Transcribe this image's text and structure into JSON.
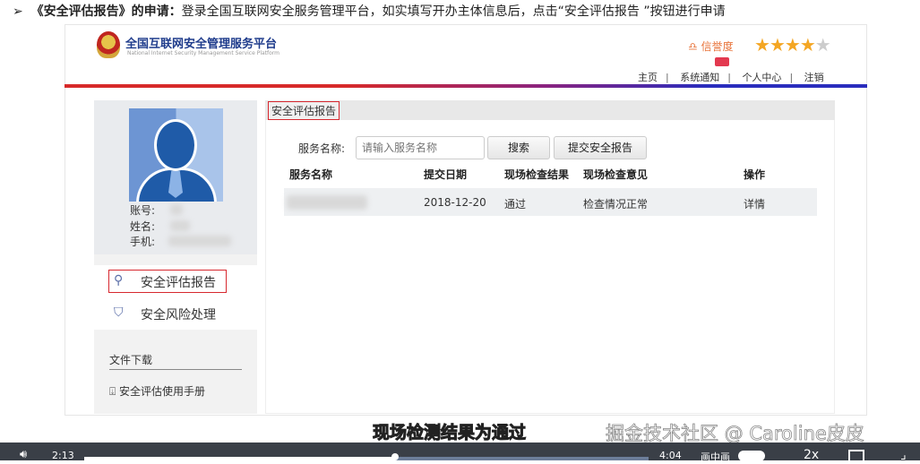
{
  "instruction": {
    "bullet": "➢",
    "bold": "《安全评估报告》的申请：",
    "text": "登录全国互联网安全服务管理平台，如实填写开办主体信息后，点击“安全评估报告 ”按钮进行申请"
  },
  "header": {
    "title": "全国互联网安全管理服务平台",
    "subtitle": "National Internet Security Management Service Platform",
    "credit_label": "信誉度",
    "stars": {
      "filled": 4,
      "total": 5
    },
    "nav": [
      "主页",
      "系统通知",
      "个人中心",
      "注销"
    ],
    "colors": {
      "accent_red": "#d72a2a",
      "accent_blue": "#2a2dbd"
    }
  },
  "profile": {
    "account_label": "账号:",
    "name_label": "姓名:",
    "phone_label": "手机:"
  },
  "sidebar": {
    "items": [
      {
        "label": "安全评估报告",
        "icon": "search-icon"
      },
      {
        "label": "安全风险处理",
        "icon": "shield-icon"
      }
    ],
    "files_title": "文件下载",
    "manual": "安全评估使用手册"
  },
  "main": {
    "tab": "安全评估报告",
    "search_label": "服务名称:",
    "search_placeholder": "请输入服务名称",
    "search_button": "搜索",
    "submit_button": "提交安全报告",
    "columns": [
      "服务名称",
      "提交日期",
      "现场检查结果",
      "现场检查意见",
      "操作"
    ],
    "rows": [
      {
        "date": "2018-12-20",
        "result": "通过",
        "opinion": "检查情况正常",
        "action": "详情"
      }
    ]
  },
  "video": {
    "subtitle": "现场检测结果为通过",
    "watermark": "掘金技术社区 @ Caroline皮皮",
    "current": "2:13",
    "duration": "4:04",
    "progress": 0.55,
    "pip": "画中画",
    "speed": "2x"
  }
}
